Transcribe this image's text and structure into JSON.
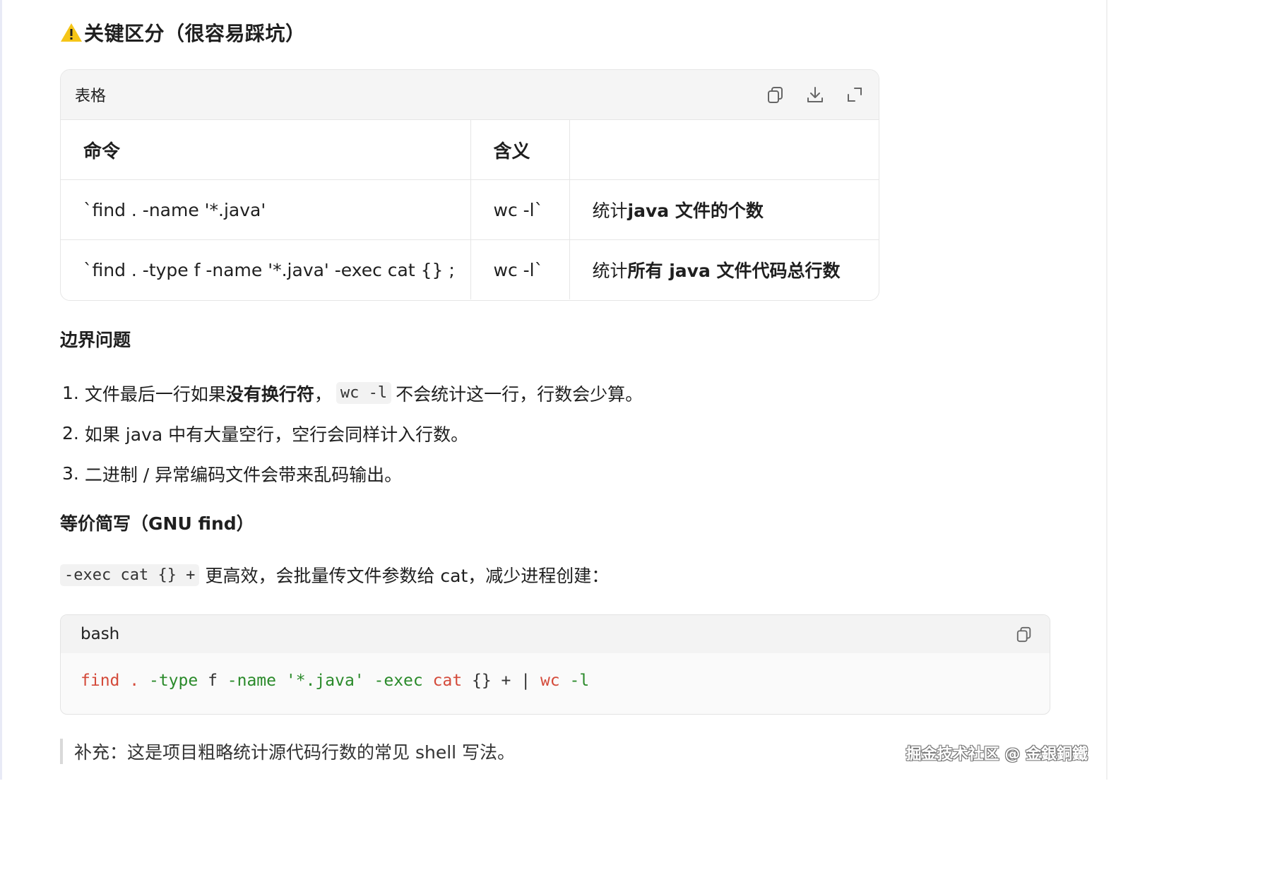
{
  "heading_main": "关键区分（很容易踩坑）",
  "table": {
    "title": "表格",
    "headers": [
      "命令",
      "含义",
      ""
    ],
    "rows": [
      [
        "`find . -name '*.java'",
        "wc -l`",
        "统计",
        "java 文件的个数"
      ],
      [
        "`find . -type f -name '*.java' -exec cat {} ;",
        "wc -l`",
        "统计",
        "所有 java 文件代码总行数"
      ]
    ]
  },
  "section_boundary": "边界问题",
  "list": [
    {
      "num": "1.",
      "pre": "文件最后一行如果",
      "bold": "没有换行符",
      "mid": "，",
      "code": "wc -l",
      "post": " 不会统计这一行，行数会少算。"
    },
    {
      "num": "2.",
      "text": "如果 java 中有大量空行，空行会同样计入行数。"
    },
    {
      "num": "3.",
      "text": "二进制 / 异常编码文件会带来乱码输出。"
    }
  ],
  "section_gnu": "等价简写（GNU find）",
  "para": {
    "code": "-exec cat {} +",
    "text": "更高效，会批量传文件参数给 cat，减少进程创建："
  },
  "code_block": {
    "lang": "bash",
    "tokens": [
      {
        "t": "find",
        "c": "cmd"
      },
      {
        "t": " ",
        "c": "plain"
      },
      {
        "t": ".",
        "c": "dot"
      },
      {
        "t": " ",
        "c": "plain"
      },
      {
        "t": "-type",
        "c": "flag"
      },
      {
        "t": " f ",
        "c": "plain"
      },
      {
        "t": "-name",
        "c": "flag"
      },
      {
        "t": " ",
        "c": "plain"
      },
      {
        "t": "'*.java'",
        "c": "str"
      },
      {
        "t": " ",
        "c": "plain"
      },
      {
        "t": "-exec",
        "c": "flag"
      },
      {
        "t": " ",
        "c": "plain"
      },
      {
        "t": "cat",
        "c": "cmd"
      },
      {
        "t": " {} + | ",
        "c": "plain"
      },
      {
        "t": "wc",
        "c": "cmd"
      },
      {
        "t": " ",
        "c": "plain"
      },
      {
        "t": "-l",
        "c": "flag"
      }
    ]
  },
  "quote": "补充：这是项目粗略统计源代码行数的常见 shell 写法。",
  "watermark": "掘金技术社区 @ 金銀銅鐵",
  "colors": {
    "warning": "#f5c518",
    "code_keyword": "#d44a3a",
    "code_flag": "#2a8a2a"
  },
  "icons": [
    "warning-icon",
    "copy-icon",
    "download-icon",
    "expand-icon"
  ]
}
